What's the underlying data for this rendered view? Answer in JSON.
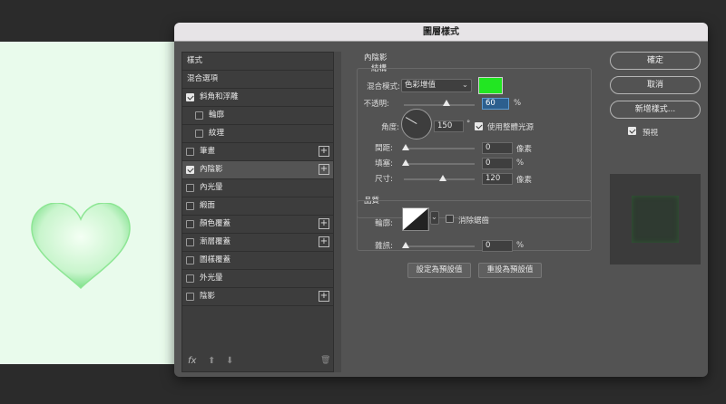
{
  "dialog": {
    "title": "圖層樣式"
  },
  "styles_list": [
    {
      "label": "樣式",
      "checkbox": false,
      "checked": false,
      "plus": false,
      "indent": 0,
      "selected": false
    },
    {
      "label": "混合選項",
      "checkbox": false,
      "checked": false,
      "plus": false,
      "indent": 0,
      "selected": false
    },
    {
      "label": "斜角和浮雕",
      "checkbox": true,
      "checked": true,
      "plus": false,
      "indent": 0,
      "selected": false
    },
    {
      "label": "輪廓",
      "checkbox": true,
      "checked": false,
      "plus": false,
      "indent": 1,
      "selected": false
    },
    {
      "label": "紋理",
      "checkbox": true,
      "checked": false,
      "plus": false,
      "indent": 1,
      "selected": false
    },
    {
      "label": "筆畫",
      "checkbox": true,
      "checked": false,
      "plus": true,
      "indent": 0,
      "selected": false
    },
    {
      "label": "內陰影",
      "checkbox": true,
      "checked": true,
      "plus": true,
      "indent": 0,
      "selected": true
    },
    {
      "label": "內光暈",
      "checkbox": true,
      "checked": false,
      "plus": false,
      "indent": 0,
      "selected": false
    },
    {
      "label": "緞面",
      "checkbox": true,
      "checked": false,
      "plus": false,
      "indent": 0,
      "selected": false
    },
    {
      "label": "顏色覆蓋",
      "checkbox": true,
      "checked": false,
      "plus": true,
      "indent": 0,
      "selected": false
    },
    {
      "label": "漸層覆蓋",
      "checkbox": true,
      "checked": false,
      "plus": true,
      "indent": 0,
      "selected": false
    },
    {
      "label": "圖樣覆蓋",
      "checkbox": true,
      "checked": false,
      "plus": false,
      "indent": 0,
      "selected": false
    },
    {
      "label": "外光暈",
      "checkbox": true,
      "checked": false,
      "plus": false,
      "indent": 0,
      "selected": false
    },
    {
      "label": "陰影",
      "checkbox": true,
      "checked": false,
      "plus": true,
      "indent": 0,
      "selected": false
    }
  ],
  "tools": {
    "fx": "fx",
    "up": "⬆",
    "down": "⬇",
    "trash": "🗑"
  },
  "inner_shadow": {
    "section_title": "內陰影",
    "structure_title": "結構",
    "blend_mode_label": "混合模式:",
    "blend_mode_value": "色彩增值",
    "shadow_color": "#22e622",
    "opacity_label": "不透明:",
    "opacity_value": "60",
    "opacity_unit": "%",
    "opacity_level": 0.6,
    "angle_label": "角度:",
    "angle_value": "150",
    "angle_unit": "°",
    "global_light_label": "使用整體光源",
    "distance_label": "間距:",
    "distance_value": "0",
    "distance_unit": "像素",
    "choke_label": "填塞:",
    "choke_value": "0",
    "choke_unit": "%",
    "size_label": "尺寸:",
    "size_value": "120",
    "size_unit": "像素",
    "quality_title": "品質",
    "contour_label": "輪廓:",
    "antialias_label": "消除鋸齒",
    "noise_label": "雜訊:",
    "noise_value": "0",
    "noise_unit": "%",
    "make_default_label": "設定為預設值",
    "reset_default_label": "重設為預設值"
  },
  "buttons": {
    "ok": "確定",
    "cancel": "取消",
    "new_style": "新增樣式...",
    "preview": "預視"
  },
  "icons": {
    "checkbox": "check-icon",
    "add": "plus-icon",
    "chevron": "chevron-down-icon"
  }
}
